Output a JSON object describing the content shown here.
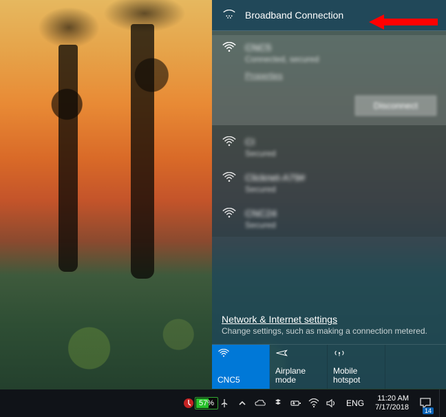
{
  "annotation": {
    "points_to": "broadband-connection-item"
  },
  "panel": {
    "broadband": {
      "label": "Broadband Connection"
    },
    "connected": {
      "ssid": "CNC5",
      "status": "Connected, secured",
      "properties_label": "Properties",
      "disconnect_label": "Disconnect"
    },
    "others": [
      {
        "ssid": "CI",
        "status": "Secured"
      },
      {
        "ssid": "Clicknet-A79#",
        "status": "Secured"
      },
      {
        "ssid": "CNC24",
        "status": "Secured"
      }
    ],
    "settings": {
      "link": "Network & Internet settings",
      "sub": "Change settings, such as making a connection metered."
    },
    "tiles": {
      "wifi": "CNC5",
      "airplane": "Airplane mode",
      "hotspot": "Mobile hotspot"
    }
  },
  "taskbar": {
    "battery_percent": "57%",
    "lang": "ENG",
    "time": "11:20 AM",
    "date": "7/17/2018",
    "notification_count": "14"
  }
}
